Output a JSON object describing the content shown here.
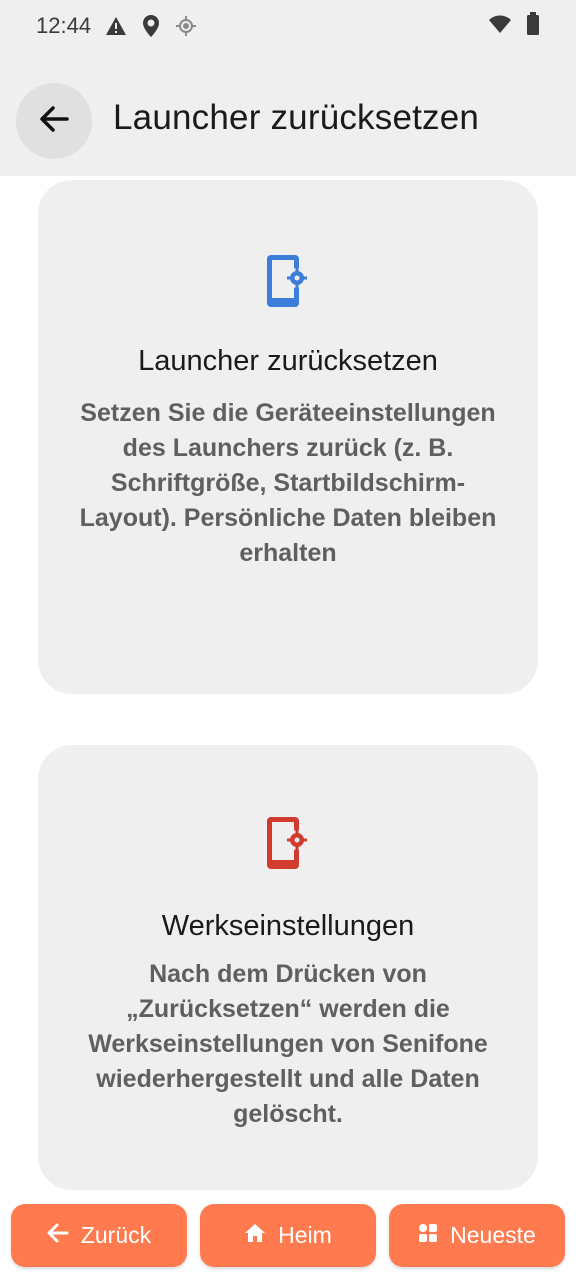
{
  "status": {
    "time": "12:44",
    "icons": [
      "warning-icon",
      "location-pin-icon",
      "gps-icon"
    ],
    "right_icons": [
      "wifi-icon",
      "battery-icon"
    ]
  },
  "header": {
    "title": "Launcher zurücksetzen",
    "back_icon": "arrow-left-icon"
  },
  "cards": [
    {
      "icon": "phone-settings-icon",
      "icon_color": "#3b7dd8",
      "title": "Launcher zurücksetzen",
      "description": "Setzen Sie die Geräteeinstellungen des Launchers zurück (z. B. Schriftgröße, Startbildschirm-Layout). Persönliche Daten bleiben erhalten"
    },
    {
      "icon": "phone-settings-icon",
      "icon_color": "#d23a2e",
      "title": "Werkseinstellungen",
      "description": "Nach dem Drücken von „Zurücksetzen“ werden die Werkseinstellungen von Senifone wiederhergestellt und alle Daten gelöscht."
    }
  ],
  "nav": {
    "back": {
      "label": "Zurück",
      "icon": "arrow-left-icon"
    },
    "home": {
      "label": "Heim",
      "icon": "home-icon"
    },
    "recent": {
      "label": "Neueste",
      "icon": "grid-icon"
    },
    "accent_color": "#ff7a4e"
  }
}
